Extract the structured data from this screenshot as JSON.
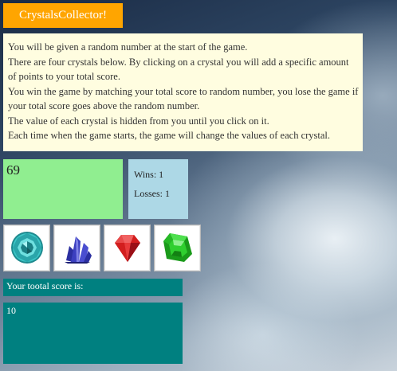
{
  "app": {
    "title": "CrystalsCollector!"
  },
  "instructions": [
    "You will be given a random number at the start of the game.",
    "There are four crystals below. By clicking on a crystal you will add a specific amount of points to your total score.",
    "You win the game by matching your total score to random number, you lose the game if your total score goes above the random number.",
    "The value of each crystal is hidden from you until you click on it.",
    "Each time when the game starts, the game will change the values of each crystal."
  ],
  "game": {
    "target_number": "69",
    "wins": "Wins: 1",
    "losses": "Losses: 1",
    "score_label": "Your tootal score is:",
    "total_score": "10"
  },
  "crystals": [
    {
      "icon": "teal-round-gem-icon",
      "color": "#3cc6c6"
    },
    {
      "icon": "blue-crystal-cluster-icon",
      "color": "#3b3fbf"
    },
    {
      "icon": "red-gem-icon",
      "color": "#d21e1e"
    },
    {
      "icon": "green-emerald-icon",
      "color": "#2fcf2f"
    }
  ],
  "colors": {
    "title_bg": "#ffa500",
    "instructions_bg": "#fffde0",
    "target_bg": "#90ee90",
    "stats_bg": "#add8e6",
    "score_bg": "#008080"
  }
}
